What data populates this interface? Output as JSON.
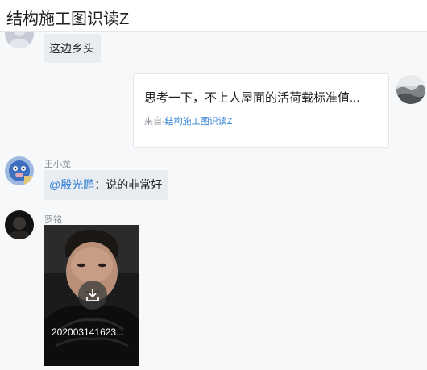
{
  "header": {
    "title": "结构施工图识读Z"
  },
  "messages": {
    "m1": {
      "text": "这边乡头"
    },
    "m2": {
      "card_title": "思考一下，不上人屋面的活荷载标准值...",
      "source_prefix": "来自-",
      "source_link": "结构施工图识读Z"
    },
    "m3": {
      "sender": "王小龙",
      "mention": "@殷光鹏",
      "text": "：说的非常好"
    },
    "m4": {
      "sender": "罗铭",
      "video_name": "202003141623..."
    }
  },
  "icons": {
    "download": "download-icon"
  },
  "colors": {
    "link": "#2f7fd6",
    "bubble": "#e9ecf0",
    "background": "#f7f8fa"
  }
}
